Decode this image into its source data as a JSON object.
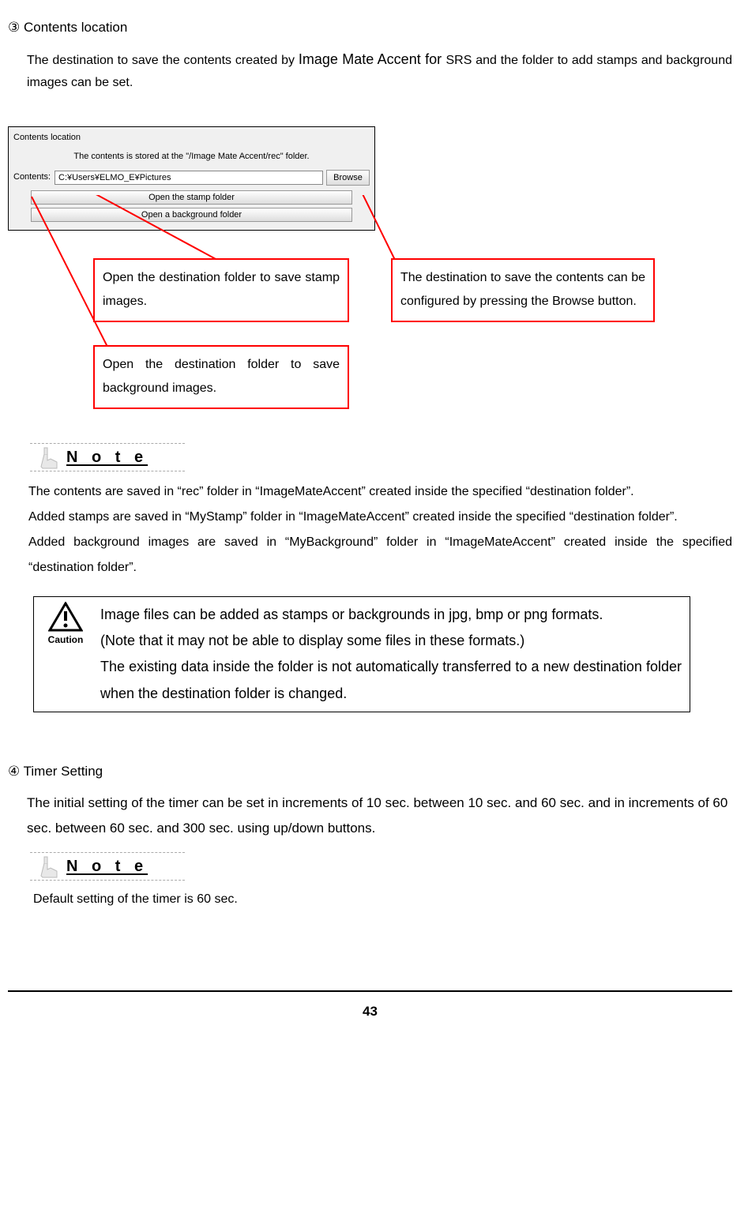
{
  "section3": {
    "heading": "③ Contents location",
    "body_before": "The destination to save the contents created by ",
    "body_mid": "Image Mate Accent for ",
    "body_after": "SRS and the folder to add stamps and background images can be set."
  },
  "dialog": {
    "title": "Contents location",
    "subtext": "The contents is stored at the \"/Image Mate Accent/rec\" folder.",
    "contents_label": "Contents:",
    "contents_path": "C:¥Users¥ELMO_E¥Pictures",
    "browse_label": "Browse",
    "stamp_btn": "Open the stamp folder",
    "bg_btn": "Open a background folder"
  },
  "callouts": {
    "c1": "Open the destination folder to save stamp images.",
    "c2": "Open the destination folder to save background images.",
    "c3": "The destination to save the contents can be configured by pressing the Browse button."
  },
  "note": {
    "label": "N o t e",
    "body1": "The contents are saved in “rec” folder in “ImageMateAccent” created inside the specified “destination folder”.",
    "body2": "Added stamps are saved in “MyStamp” folder in “ImageMateAccent” created inside the specified “destination folder”.",
    "body3": "Added background images are saved in “MyBackground” folder in “ImageMateAccent” created inside the specified “destination folder”."
  },
  "caution": {
    "label": "Caution",
    "line1": "Image files can be added as stamps or backgrounds in jpg, bmp or png formats.",
    "line2": "(Note that it may not be able to display some files in these formats.)",
    "line3": "The existing data inside the folder is not automatically transferred to a new destination folder when the destination folder is changed."
  },
  "section4": {
    "heading": "④ Timer Setting",
    "body": "The initial setting of the timer can be set in increments of 10 sec. between 10 sec. and 60 sec. and in increments of 60 sec. between 60 sec. and 300 sec. using up/down buttons.",
    "note_label": "N o t e",
    "default_text": "Default setting of the timer is 60 sec."
  },
  "page_number": "43"
}
